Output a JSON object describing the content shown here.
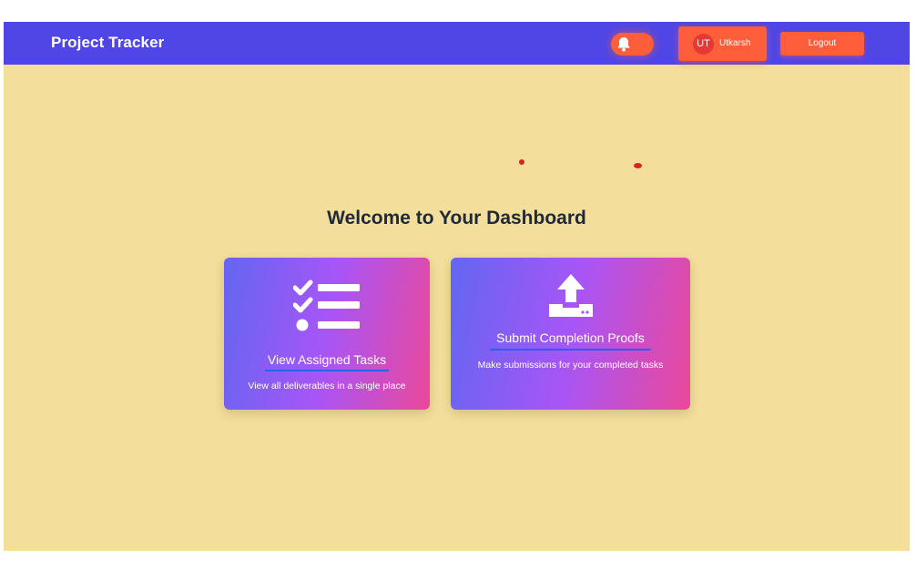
{
  "header": {
    "brand": "Project Tracker",
    "notification_icon": "bell-icon",
    "user": {
      "initials": "UT",
      "name": "Utkarsh"
    },
    "logout_label": "Logout"
  },
  "main": {
    "welcome_title": "Welcome to Your Dashboard",
    "cards": [
      {
        "icon": "task-list-icon",
        "title": "View Assigned Tasks",
        "description": "View all deliverables in a single place"
      },
      {
        "icon": "upload-icon",
        "title": "Submit Completion Proofs",
        "description": "Make submissions for your completed tasks"
      }
    ]
  },
  "colors": {
    "navbar": "#4f46e5",
    "background": "#f4de9b",
    "accent_button": "#ff5e3a",
    "card_gradient": [
      "#6366f1",
      "#a855f7",
      "#ec4899"
    ],
    "underline": "#2563eb"
  }
}
